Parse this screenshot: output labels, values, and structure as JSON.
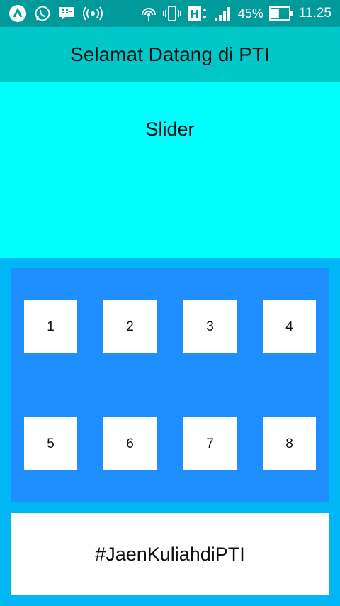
{
  "status_bar": {
    "icons": [
      "app-logo-icon",
      "whatsapp-icon",
      "bbm-icon",
      "hotspot-icon",
      "wifi-icon",
      "vibrate-icon",
      "h-network-icon",
      "signal-icon",
      "battery-icon"
    ],
    "network": "H",
    "battery_percent": "45%",
    "battery_level": 0.45,
    "time": "11.25"
  },
  "header": {
    "title": "Selamat Datang di PTI"
  },
  "slider": {
    "label": "Slider"
  },
  "grid": {
    "items": [
      "1",
      "2",
      "3",
      "4",
      "5",
      "6",
      "7",
      "8"
    ]
  },
  "footer": {
    "text": "#JaenKuliahdiPTI"
  },
  "colors": {
    "status_bar": "#009a9a",
    "header": "#00c8c8",
    "slider": "#00ffff",
    "background": "#00b6f5",
    "grid_panel": "#1f8fff",
    "tile": "#ffffff"
  }
}
